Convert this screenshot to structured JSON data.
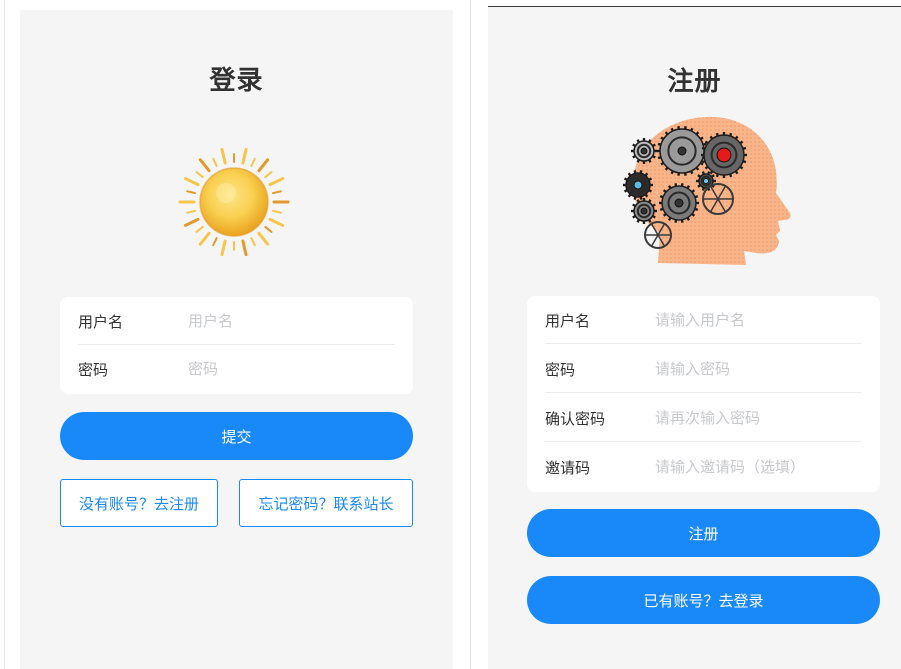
{
  "colors": {
    "primary": "#1989fa",
    "panel_bg": "#f5f5f5",
    "card_bg": "#ffffff",
    "text": "#323233",
    "placeholder": "#c8c9cc"
  },
  "login": {
    "title": "登录",
    "illustration": "sun-illustration",
    "fields": [
      {
        "label": "用户名",
        "placeholder": "用户名"
      },
      {
        "label": "密码",
        "placeholder": "密码"
      }
    ],
    "submit_label": "提交",
    "register_link_label": "没有账号？去注册",
    "forgot_link_label": "忘记密码？联系站长"
  },
  "register": {
    "title": "注册",
    "illustration": "head-with-gears-illustration",
    "fields": [
      {
        "label": "用户名",
        "placeholder": "请输入用户名"
      },
      {
        "label": "密码",
        "placeholder": "请输入密码"
      },
      {
        "label": "确认密码",
        "placeholder": "请再次输入密码"
      },
      {
        "label": "邀请码",
        "placeholder": "请输入邀请码（选填）"
      }
    ],
    "submit_label": "注册",
    "login_link_label": "已有账号？去登录"
  }
}
